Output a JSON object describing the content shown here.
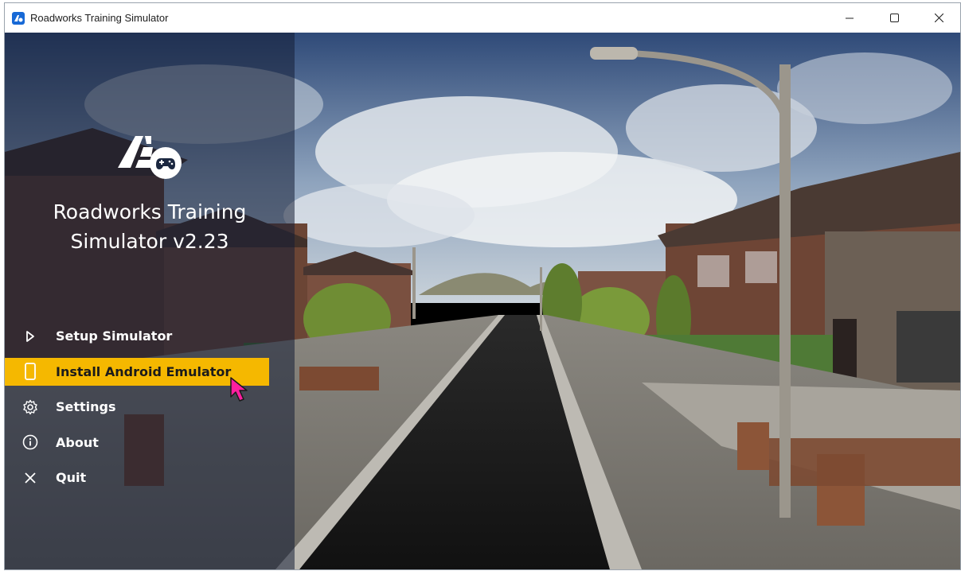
{
  "window": {
    "title": "Roadworks Training Simulator",
    "controls": [
      "minimize",
      "maximize",
      "close"
    ]
  },
  "app": {
    "title_line1": "Roadworks Training",
    "title_line2": "Simulator v2.23",
    "logo_icon": "road-gamepad-logo-icon"
  },
  "menu": {
    "items": [
      {
        "label": "Setup Simulator",
        "icon": "play-icon",
        "active": false
      },
      {
        "label": "Install Android Emulator",
        "icon": "phone-icon",
        "active": true
      },
      {
        "label": "Settings",
        "icon": "gear-icon",
        "active": false
      },
      {
        "label": "About",
        "icon": "info-icon",
        "active": false
      },
      {
        "label": "Quit",
        "icon": "close-icon",
        "active": false
      }
    ]
  },
  "colors": {
    "accent": "#f5b800",
    "sidebar": "#141e34",
    "cursor": "#ff1fa0"
  }
}
